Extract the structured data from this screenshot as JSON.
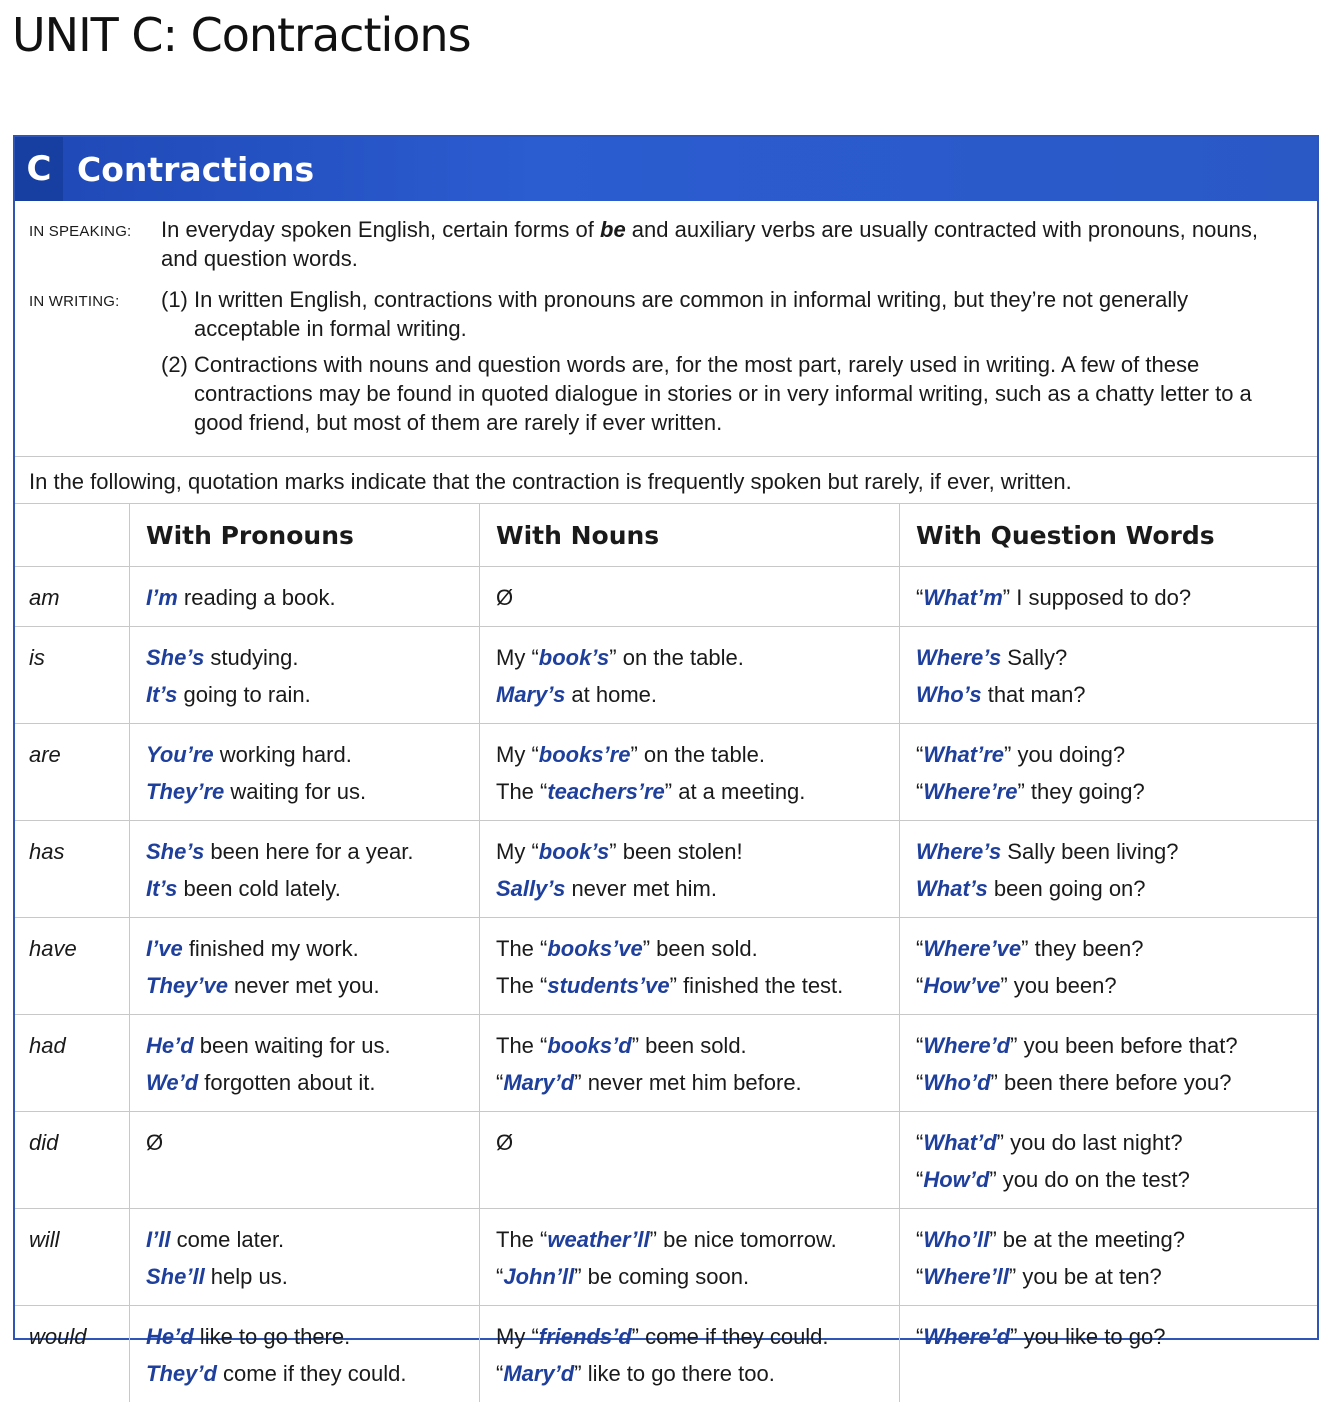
{
  "unit_title": "UNIT C:  Contractions",
  "section": {
    "badge": "C",
    "title": "Contractions"
  },
  "speaking": {
    "label": "IN SPEAKING:",
    "pre": "In everyday spoken English, certain forms of ",
    "em": "be",
    "post": " and auxiliary verbs are usually contracted with pronouns, nouns, and question words."
  },
  "writing": {
    "label": "IN WRITING:",
    "items": [
      {
        "num": "(1)",
        "text": "In written English, contractions with pronouns are common in informal writing, but they’re not generally acceptable in formal writing."
      },
      {
        "num": "(2)",
        "text": "Contractions with nouns and question words are, for the most part, rarely used in writing.  A few of these contractions may be found in quoted dialogue in stories or in very informal writing, such as a chatty letter to a good friend, but most of them are rarely if ever written."
      }
    ]
  },
  "intro": "In the following, quotation marks indicate that the contraction is frequently spoken but rarely, if ever, written.",
  "headers": [
    "",
    "With Pronouns",
    "With Nouns",
    "With Question Words"
  ],
  "rows": [
    {
      "verb": "am",
      "pron": [
        {
          "hl": "I’m",
          "rest": " reading a book."
        }
      ],
      "noun": [
        {
          "pre": "",
          "hl": "",
          "rest": "Ø"
        }
      ],
      "q": [
        {
          "pre": "“",
          "hl": "What’m",
          "rest": "” I supposed to do?"
        }
      ]
    },
    {
      "verb": "is",
      "pron": [
        {
          "hl": "She’s",
          "rest": " studying."
        },
        {
          "hl": "It’s",
          "rest": " going to rain."
        }
      ],
      "noun": [
        {
          "pre": "My “",
          "hl": "book’s",
          "rest": "” on the table."
        },
        {
          "pre": "",
          "hl": "Mary’s",
          "rest": " at home."
        }
      ],
      "q": [
        {
          "pre": "",
          "hl": "Where’s",
          "rest": " Sally?"
        },
        {
          "pre": "",
          "hl": "Who’s",
          "rest": " that man?"
        }
      ]
    },
    {
      "verb": "are",
      "pron": [
        {
          "hl": "You’re",
          "rest": " working hard."
        },
        {
          "hl": "They’re",
          "rest": " waiting for us."
        }
      ],
      "noun": [
        {
          "pre": "My “",
          "hl": "books’re",
          "rest": "” on the table."
        },
        {
          "pre": "The “",
          "hl": "teachers’re",
          "rest": "” at a meeting."
        }
      ],
      "q": [
        {
          "pre": "“",
          "hl": "What’re",
          "rest": "” you doing?"
        },
        {
          "pre": "“",
          "hl": "Where’re",
          "rest": "” they going?"
        }
      ]
    },
    {
      "verb": "has",
      "pron": [
        {
          "hl": "She’s",
          "rest": " been here for a year."
        },
        {
          "hl": "It’s",
          "rest": " been cold lately."
        }
      ],
      "noun": [
        {
          "pre": "My “",
          "hl": "book’s",
          "rest": "” been stolen!"
        },
        {
          "pre": "",
          "hl": "Sally’s",
          "rest": " never met him."
        }
      ],
      "q": [
        {
          "pre": "",
          "hl": "Where’s",
          "rest": " Sally been living?"
        },
        {
          "pre": "",
          "hl": "What’s",
          "rest": " been going on?"
        }
      ]
    },
    {
      "verb": "have",
      "pron": [
        {
          "hl": "I’ve",
          "rest": " finished my work."
        },
        {
          "hl": "They’ve",
          "rest": " never met you."
        }
      ],
      "noun": [
        {
          "pre": "The “",
          "hl": "books’ve",
          "rest": "” been sold."
        },
        {
          "pre": "The “",
          "hl": "students’ve",
          "rest": "” finished the test."
        }
      ],
      "q": [
        {
          "pre": "“",
          "hl": "Where’ve",
          "rest": "” they been?"
        },
        {
          "pre": "“",
          "hl": "How’ve",
          "rest": "” you been?"
        }
      ]
    },
    {
      "verb": "had",
      "pron": [
        {
          "hl": "He’d",
          "rest": " been waiting for us."
        },
        {
          "hl": "We’d",
          "rest": " forgotten about it."
        }
      ],
      "noun": [
        {
          "pre": "The “",
          "hl": "books’d",
          "rest": "” been sold."
        },
        {
          "pre": "“",
          "hl": "Mary’d",
          "rest": "” never met him before."
        }
      ],
      "q": [
        {
          "pre": "“",
          "hl": "Where’d",
          "rest": "” you been before that?"
        },
        {
          "pre": "“",
          "hl": "Who’d",
          "rest": "” been there before you?"
        }
      ]
    },
    {
      "verb": "did",
      "pron": [
        {
          "hl": "",
          "rest": "Ø"
        }
      ],
      "noun": [
        {
          "pre": "",
          "hl": "",
          "rest": "Ø"
        }
      ],
      "q": [
        {
          "pre": "“",
          "hl": "What’d",
          "rest": "” you do last night?"
        },
        {
          "pre": "“",
          "hl": "How’d",
          "rest": "” you do on the test?"
        }
      ]
    },
    {
      "verb": "will",
      "pron": [
        {
          "hl": "I’ll",
          "rest": " come later."
        },
        {
          "hl": "She’ll",
          "rest": " help us."
        }
      ],
      "noun": [
        {
          "pre": "The “",
          "hl": "weather’ll",
          "rest": "” be nice tomorrow."
        },
        {
          "pre": "“",
          "hl": "John’ll",
          "rest": "” be coming soon."
        }
      ],
      "q": [
        {
          "pre": "“",
          "hl": "Who’ll",
          "rest": "” be at the meeting?"
        },
        {
          "pre": "“",
          "hl": "Where’ll",
          "rest": "” you be at ten?"
        }
      ]
    },
    {
      "verb": "would",
      "pron": [
        {
          "hl": "He’d",
          "rest": " like to go there."
        },
        {
          "hl": "They’d",
          "rest": " come if they could."
        }
      ],
      "noun": [
        {
          "pre": "My “",
          "hl": "friends’d",
          "rest": "” come if they could."
        },
        {
          "pre": "“",
          "hl": "Mary’d",
          "rest": "” like to go there too."
        }
      ],
      "q": [
        {
          "pre": "“",
          "hl": "Where’d",
          "rest": "” you like to go?"
        }
      ]
    }
  ]
}
